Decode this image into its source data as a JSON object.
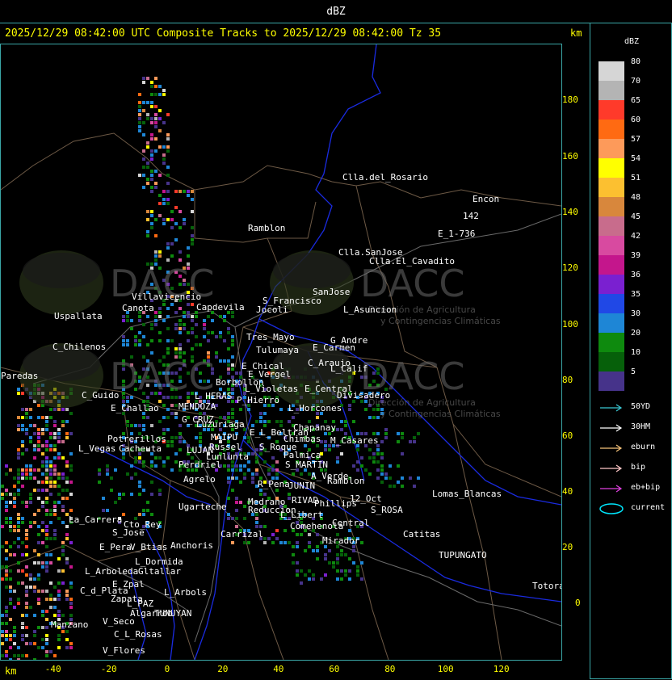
{
  "header": {
    "title": "dBZ"
  },
  "subtitle": "2025/12/29 08:42:00 UTC Composite Tracks to 2025/12/29 08:42:00 Tz 35",
  "axes": {
    "unit": "km",
    "y_ticks": [
      "180",
      "160",
      "140",
      "120",
      "100",
      "80",
      "60",
      "40",
      "20",
      "0"
    ],
    "x_ticks": [
      "-40",
      "-20",
      "0",
      "20",
      "40",
      "60",
      "80",
      "100",
      "120"
    ]
  },
  "legend": {
    "title": "dBZ",
    "levels": [
      {
        "label": "80",
        "color": "#d6d6d6"
      },
      {
        "label": "70",
        "color": "#b4b4b4"
      },
      {
        "label": "65",
        "color": "#ff3a2a"
      },
      {
        "label": "60",
        "color": "#ff6a12"
      },
      {
        "label": "57",
        "color": "#fd9a5a"
      },
      {
        "label": "54",
        "color": "#ffff00"
      },
      {
        "label": "51",
        "color": "#fcc030"
      },
      {
        "label": "48",
        "color": "#d8873c"
      },
      {
        "label": "45",
        "color": "#c86c8c"
      },
      {
        "label": "42",
        "color": "#d84aa0"
      },
      {
        "label": "39",
        "color": "#c4168c"
      },
      {
        "label": "36",
        "color": "#7a20d0"
      },
      {
        "label": "35",
        "color": "#2048e6"
      },
      {
        "label": "30",
        "color": "#1e86d6"
      },
      {
        "label": "20",
        "color": "#0e8a0e"
      },
      {
        "label": "10",
        "color": "#06600a"
      },
      {
        "label": "5",
        "color": "#46338a"
      }
    ],
    "tracks": [
      {
        "label": "50YD",
        "color": "#3ac8d4",
        "kind": "arrow"
      },
      {
        "label": "30HM",
        "color": "#ffffff",
        "kind": "arrow"
      },
      {
        "label": "eburn",
        "color": "#f5c27a",
        "kind": "arrow"
      },
      {
        "label": "bip",
        "color": "#ffc8c8",
        "kind": "arrow"
      },
      {
        "label": "eb+bip",
        "color": "#e040e0",
        "kind": "arrow"
      },
      {
        "label": "current",
        "color": "#00e8ff",
        "kind": "ellipse"
      }
    ]
  },
  "watermark": {
    "brand": "DACC",
    "line1": "Dirección de Agricultura",
    "line2": "y Contingencias Climáticas"
  },
  "places": [
    {
      "name": "Clla.del_Rosario"
    },
    {
      "name": "Encon"
    },
    {
      "name": "142"
    },
    {
      "name": "E_1-736"
    },
    {
      "name": "Ramblon"
    },
    {
      "name": "Clla.SanJose"
    },
    {
      "name": "Clla.El_Cavadito"
    },
    {
      "name": "Villavicencio"
    },
    {
      "name": "Canota"
    },
    {
      "name": "Capdevila"
    },
    {
      "name": "S_Francisco"
    },
    {
      "name": "Jocoli"
    },
    {
      "name": "SanJose"
    },
    {
      "name": "L_Asuncion"
    },
    {
      "name": "Uspallata"
    },
    {
      "name": "Tres_Mayo"
    },
    {
      "name": "Tulumaya"
    },
    {
      "name": "G_Andre"
    },
    {
      "name": "E_Carmen"
    },
    {
      "name": "C_Chilenos"
    },
    {
      "name": "E_Chical"
    },
    {
      "name": "E_Vergel"
    },
    {
      "name": "C_Araujo"
    },
    {
      "name": "L_Calif"
    },
    {
      "name": "Paredas"
    },
    {
      "name": "L_Violetas"
    },
    {
      "name": "Borbollon"
    },
    {
      "name": "E_Central"
    },
    {
      "name": "Divisadero"
    },
    {
      "name": "C_Guido"
    },
    {
      "name": "L_HERAS"
    },
    {
      "name": "P_Hierro"
    },
    {
      "name": "L_Horcones"
    },
    {
      "name": "E_Challao"
    },
    {
      "name": "MENDOZA"
    },
    {
      "name": "G_CRUZ"
    },
    {
      "name": "Luzuriaga"
    },
    {
      "name": "Chapanay"
    },
    {
      "name": "E_L_Beltran"
    },
    {
      "name": "Chimbas"
    },
    {
      "name": "M_Casares"
    },
    {
      "name": "Potrerillos"
    },
    {
      "name": "MAIPU"
    },
    {
      "name": "Russel"
    },
    {
      "name": "S_Roque"
    },
    {
      "name": "L_Vegas"
    },
    {
      "name": "Cacheuta"
    },
    {
      "name": "LUJAN"
    },
    {
      "name": "Lunlunta"
    },
    {
      "name": "Palmica"
    },
    {
      "name": "Perdriel"
    },
    {
      "name": "S_MARTIN"
    },
    {
      "name": "A_Verde"
    },
    {
      "name": "Agrelo"
    },
    {
      "name": "R_Pena"
    },
    {
      "name": "JUNIN"
    },
    {
      "name": "Ramblon"
    },
    {
      "name": "Lomas_Blancas"
    },
    {
      "name": "Medrano"
    },
    {
      "name": "RIVAD"
    },
    {
      "name": "Phillips"
    },
    {
      "name": "12_Oct"
    },
    {
      "name": "Ugarteche"
    },
    {
      "name": "Reduccion"
    },
    {
      "name": "S_ROSA"
    },
    {
      "name": "La_Carrera"
    },
    {
      "name": "Cto_Rey"
    },
    {
      "name": "L_Libert"
    },
    {
      "name": "Central"
    },
    {
      "name": "S_Jose"
    },
    {
      "name": "Carrizal"
    },
    {
      "name": "Comehenola"
    },
    {
      "name": "Catitas"
    },
    {
      "name": "Mirador"
    },
    {
      "name": "E_Pera"
    },
    {
      "name": "Anchoris"
    },
    {
      "name": "V_Btias"
    },
    {
      "name": "TUPUNGATO"
    },
    {
      "name": "L_Dormida"
    },
    {
      "name": "L_Arboleda"
    },
    {
      "name": "Gltallar"
    },
    {
      "name": "E_Zpal"
    },
    {
      "name": "C_d_Plata"
    },
    {
      "name": "L_Arbols"
    },
    {
      "name": "Zapata"
    },
    {
      "name": "L_PAZ"
    },
    {
      "name": "Algarrob"
    },
    {
      "name": "V_Seco"
    },
    {
      "name": "Totoral"
    },
    {
      "name": "TUNUYAN"
    },
    {
      "name": "Manzano"
    },
    {
      "name": "C_L_Rosas"
    },
    {
      "name": "V_Flores"
    }
  ]
}
